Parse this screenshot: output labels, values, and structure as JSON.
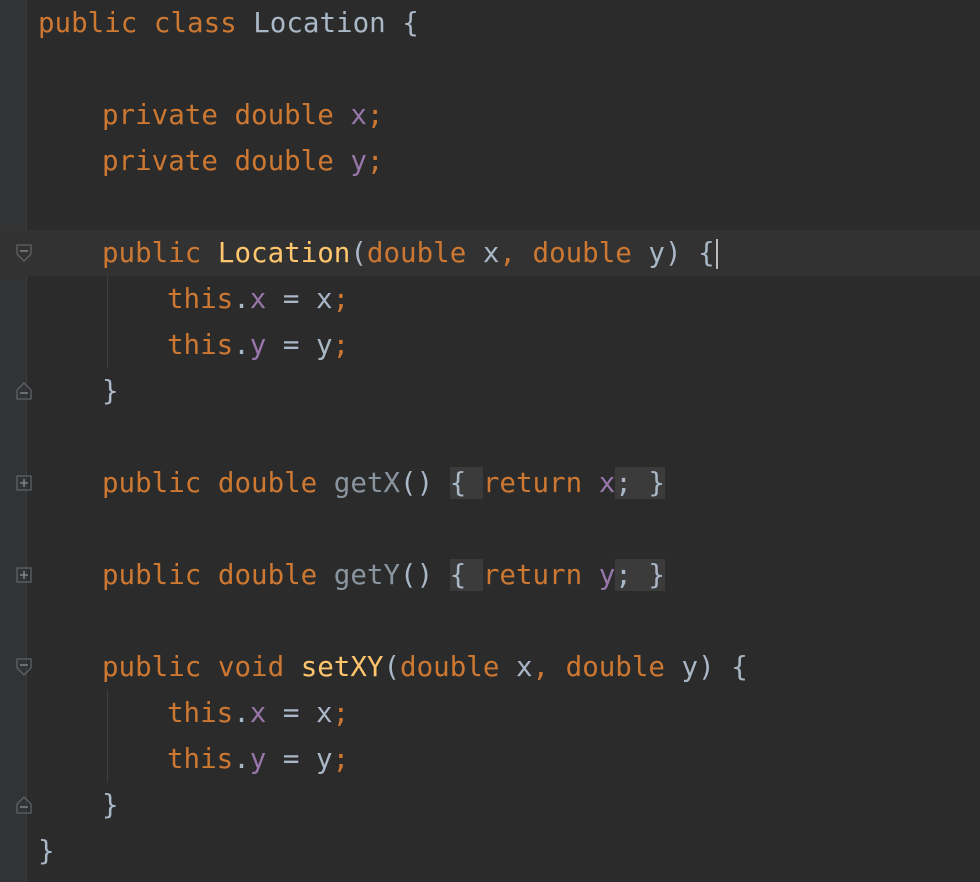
{
  "editor": {
    "lines": [
      {
        "tokens": [
          {
            "t": "public class ",
            "c": "kw"
          },
          {
            "t": "Location ",
            "c": "plain"
          },
          {
            "t": "{",
            "c": "plain"
          }
        ]
      },
      {
        "tokens": []
      },
      {
        "tokens": [
          {
            "t": "private double ",
            "c": "kw"
          },
          {
            "t": "x",
            "c": "fld"
          },
          {
            "t": ";",
            "c": "kw"
          }
        ]
      },
      {
        "tokens": [
          {
            "t": "private double ",
            "c": "kw"
          },
          {
            "t": "y",
            "c": "fld"
          },
          {
            "t": ";",
            "c": "kw"
          }
        ]
      },
      {
        "tokens": []
      },
      {
        "tokens": [
          {
            "t": "public ",
            "c": "kw"
          },
          {
            "t": "Location",
            "c": "fn"
          },
          {
            "t": "(",
            "c": "plain"
          },
          {
            "t": "double ",
            "c": "kw"
          },
          {
            "t": "x",
            "c": "plain"
          },
          {
            "t": ", ",
            "c": "kw"
          },
          {
            "t": "double ",
            "c": "kw"
          },
          {
            "t": "y",
            "c": "plain"
          },
          {
            "t": ") {",
            "c": "plain"
          }
        ]
      },
      {
        "tokens": [
          {
            "t": "this",
            "c": "kw"
          },
          {
            "t": ".",
            "c": "plain"
          },
          {
            "t": "x",
            "c": "fld"
          },
          {
            "t": " = x",
            "c": "plain"
          },
          {
            "t": ";",
            "c": "kw"
          }
        ]
      },
      {
        "tokens": [
          {
            "t": "this",
            "c": "kw"
          },
          {
            "t": ".",
            "c": "plain"
          },
          {
            "t": "y",
            "c": "fld"
          },
          {
            "t": " = y",
            "c": "plain"
          },
          {
            "t": ";",
            "c": "kw"
          }
        ]
      },
      {
        "tokens": [
          {
            "t": "}",
            "c": "plain"
          }
        ]
      },
      {
        "tokens": []
      },
      {
        "tokens": [
          {
            "t": "public double ",
            "c": "kw"
          },
          {
            "t": "getX",
            "c": "muted"
          },
          {
            "t": "() ",
            "c": "plain"
          },
          {
            "t": "{ ",
            "c": "folded"
          },
          {
            "t": "return ",
            "c": "kw"
          },
          {
            "t": "x",
            "c": "fld"
          },
          {
            "t": "; }",
            "c": "folded"
          }
        ]
      },
      {
        "tokens": []
      },
      {
        "tokens": [
          {
            "t": "public double ",
            "c": "kw"
          },
          {
            "t": "getY",
            "c": "muted"
          },
          {
            "t": "() ",
            "c": "plain"
          },
          {
            "t": "{ ",
            "c": "folded"
          },
          {
            "t": "return ",
            "c": "kw"
          },
          {
            "t": "y",
            "c": "fld"
          },
          {
            "t": "; }",
            "c": "folded"
          }
        ]
      },
      {
        "tokens": []
      },
      {
        "tokens": [
          {
            "t": "public void ",
            "c": "kw"
          },
          {
            "t": "setXY",
            "c": "fn"
          },
          {
            "t": "(",
            "c": "plain"
          },
          {
            "t": "double ",
            "c": "kw"
          },
          {
            "t": "x",
            "c": "plain"
          },
          {
            "t": ", ",
            "c": "kw"
          },
          {
            "t": "double ",
            "c": "kw"
          },
          {
            "t": "y",
            "c": "plain"
          },
          {
            "t": ") {",
            "c": "plain"
          }
        ]
      },
      {
        "tokens": [
          {
            "t": "this",
            "c": "kw"
          },
          {
            "t": ".",
            "c": "plain"
          },
          {
            "t": "x",
            "c": "fld"
          },
          {
            "t": " = x",
            "c": "plain"
          },
          {
            "t": ";",
            "c": "kw"
          }
        ]
      },
      {
        "tokens": [
          {
            "t": "this",
            "c": "kw"
          },
          {
            "t": ".",
            "c": "plain"
          },
          {
            "t": "y",
            "c": "fld"
          },
          {
            "t": " = y",
            "c": "plain"
          },
          {
            "t": ";",
            "c": "kw"
          }
        ]
      },
      {
        "tokens": [
          {
            "t": "}",
            "c": "plain"
          }
        ]
      },
      {
        "tokens": [
          {
            "t": "}",
            "c": "plain"
          }
        ]
      }
    ]
  },
  "gutter": {
    "fold_markers": [
      {
        "line": 5,
        "icon": "fold-collapse-icon"
      },
      {
        "line": 8,
        "icon": "fold-end-icon"
      },
      {
        "line": 10,
        "icon": "fold-expand-icon"
      },
      {
        "line": 12,
        "icon": "fold-expand-icon"
      },
      {
        "line": 14,
        "icon": "fold-collapse-icon"
      },
      {
        "line": 17,
        "icon": "fold-end-icon"
      }
    ]
  },
  "colors": {
    "background": "#2b2b2b",
    "keyword": "#cc7832",
    "field": "#9876aa",
    "method": "#ffc66d",
    "text": "#a9b7c6",
    "current_line": "#323232"
  },
  "caret": {
    "line": 5
  }
}
